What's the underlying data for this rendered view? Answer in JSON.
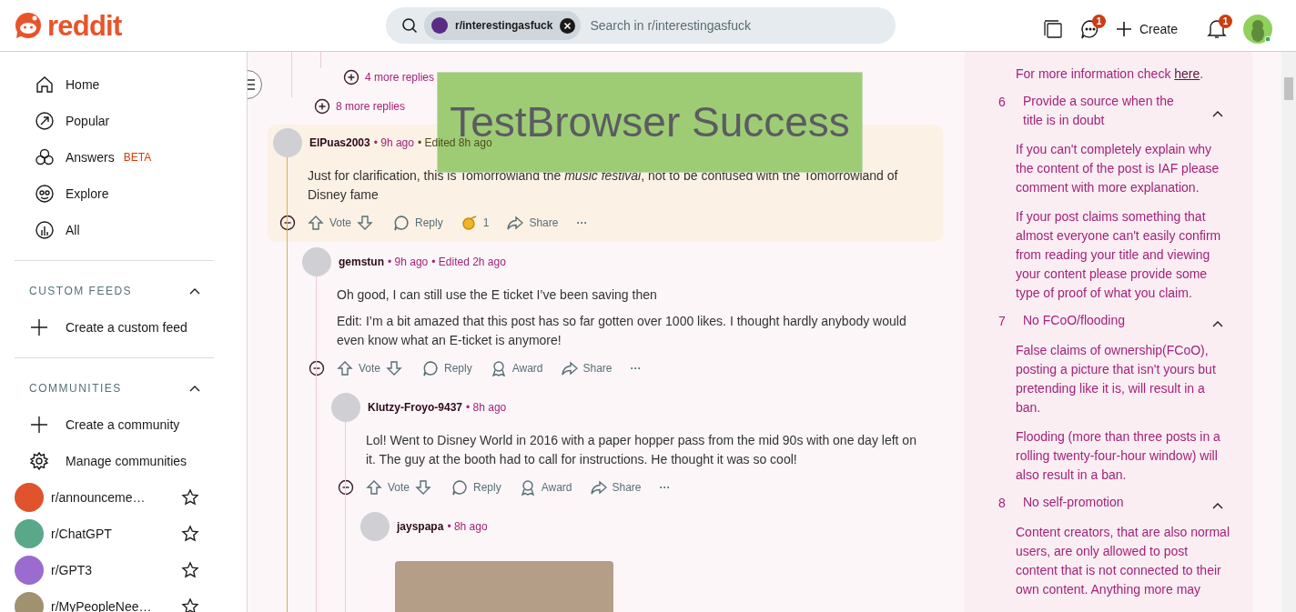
{
  "header": {
    "logo": "reddit",
    "search": {
      "chip": "r/interestingasfuck",
      "placeholder": "Search in r/interestingasfuck"
    },
    "chat_badge": "1",
    "create": "Create",
    "notifications_badge": "1"
  },
  "sidebar": {
    "nav": [
      {
        "label": "Home",
        "kind": "home",
        "selected": false
      },
      {
        "label": "Popular",
        "kind": "popular",
        "selected": false
      },
      {
        "label": "Answers",
        "kind": "answers",
        "badge": "BETA",
        "selected": false
      },
      {
        "label": "Explore",
        "kind": "explore",
        "selected": false
      },
      {
        "label": "All",
        "kind": "all",
        "selected": false
      }
    ],
    "sections": [
      {
        "title": "CUSTOM FEEDS",
        "expanded": true,
        "items": [
          {
            "label": "Create a custom feed",
            "kind": "plus"
          }
        ]
      },
      {
        "title": "COMMUNITIES",
        "expanded": true,
        "items": [
          {
            "label": "Create a community",
            "kind": "plus"
          },
          {
            "label": "Manage communities",
            "kind": "gear"
          },
          {
            "label": "r/announceme…",
            "kind": "community",
            "color": "#e0532c",
            "favorite": false
          },
          {
            "label": "r/ChatGPT",
            "kind": "community",
            "color": "#5aa88a",
            "favorite": false
          },
          {
            "label": "r/GPT3",
            "kind": "community",
            "color": "#9b6bd0",
            "favorite": false
          },
          {
            "label": "r/MyPeopleNee…",
            "kind": "community",
            "color": "#a09270",
            "favorite": false
          }
        ]
      }
    ]
  },
  "thread": {
    "more_replies": [
      "4 more replies",
      "8 more replies"
    ],
    "comments": [
      {
        "author": "ElPuas2003",
        "time": "• 9h ago",
        "edited": "• Edited 8h ago",
        "highlighted": true,
        "paragraphs": [
          "Just for clarification, this is Tomorrowland the *music festival*, not to be confused with the Tomorrowland of Disney fame"
        ],
        "actions": [
          {
            "kind": "vote",
            "label": "Vote"
          },
          {
            "kind": "reply",
            "label": "Reply"
          },
          {
            "kind": "award_count",
            "label": "1"
          },
          {
            "kind": "share",
            "label": "Share"
          },
          {
            "kind": "more",
            "label": "···"
          }
        ],
        "children": [
          {
            "author": "gemstun",
            "time": "• 9h ago",
            "edited": "• Edited 2h ago",
            "highlighted": false,
            "paragraphs": [
              "Oh good, I can still use the E ticket I’ve been saving then",
              "Edit: I’m a bit amazed that this post has so far gotten over 1000 likes. I thought hardly anybody would even know what an E-ticket is anymore!"
            ],
            "actions": [
              {
                "kind": "vote",
                "label": "Vote"
              },
              {
                "kind": "reply",
                "label": "Reply"
              },
              {
                "kind": "award",
                "label": "Award"
              },
              {
                "kind": "share",
                "label": "Share"
              },
              {
                "kind": "more",
                "label": "···"
              }
            ],
            "children": [
              {
                "author": "Klutzy-Froyo-9437",
                "time": "• 8h ago",
                "highlighted": false,
                "paragraphs": [
                  "Lol! Went to Disney World in 2016 with a paper hopper pass from the mid 90s with one day left on it. The guy at the booth had to call for instructions. He thought it was so cool!"
                ],
                "actions": [
                  {
                    "kind": "vote",
                    "label": "Vote"
                  },
                  {
                    "kind": "reply",
                    "label": "Reply"
                  },
                  {
                    "kind": "award",
                    "label": "Award"
                  },
                  {
                    "kind": "share",
                    "label": "Share"
                  },
                  {
                    "kind": "more",
                    "label": "···"
                  }
                ],
                "children": [
                  {
                    "author": "jayspapa",
                    "time": "• 8h ago",
                    "highlighted": false,
                    "image": true
                  }
                ]
              }
            ]
          }
        ]
      }
    ]
  },
  "overlay": {
    "text": "TestBrowser Success"
  },
  "rules": {
    "intro": "For more information check **here**.",
    "items": [
      {
        "number": "6",
        "title": "Provide a source when the title is in doubt",
        "expanded": true,
        "paragraphs": [
          "If you can't completely explain why the content of the post is IAF please comment with more explanation.",
          "If your post claims something that almost everyone can't easily confirm from reading your title and viewing your content please provide some type of proof of what you claim."
        ]
      },
      {
        "number": "7",
        "title": "No FCoO/flooding",
        "expanded": true,
        "paragraphs": [
          "False claims of ownership(FCoO), posting a picture that isn't yours but pretending like it is, will result in a ban.",
          "Flooding (more than three posts in a rolling twenty-four-hour window) will also result in a ban."
        ]
      },
      {
        "number": "8",
        "title": "No self-promotion",
        "expanded": true,
        "paragraphs": [
          "Content creators, that are also normal users, are only allowed to post content that is not connected to their own content. Anything more may"
        ]
      }
    ]
  }
}
